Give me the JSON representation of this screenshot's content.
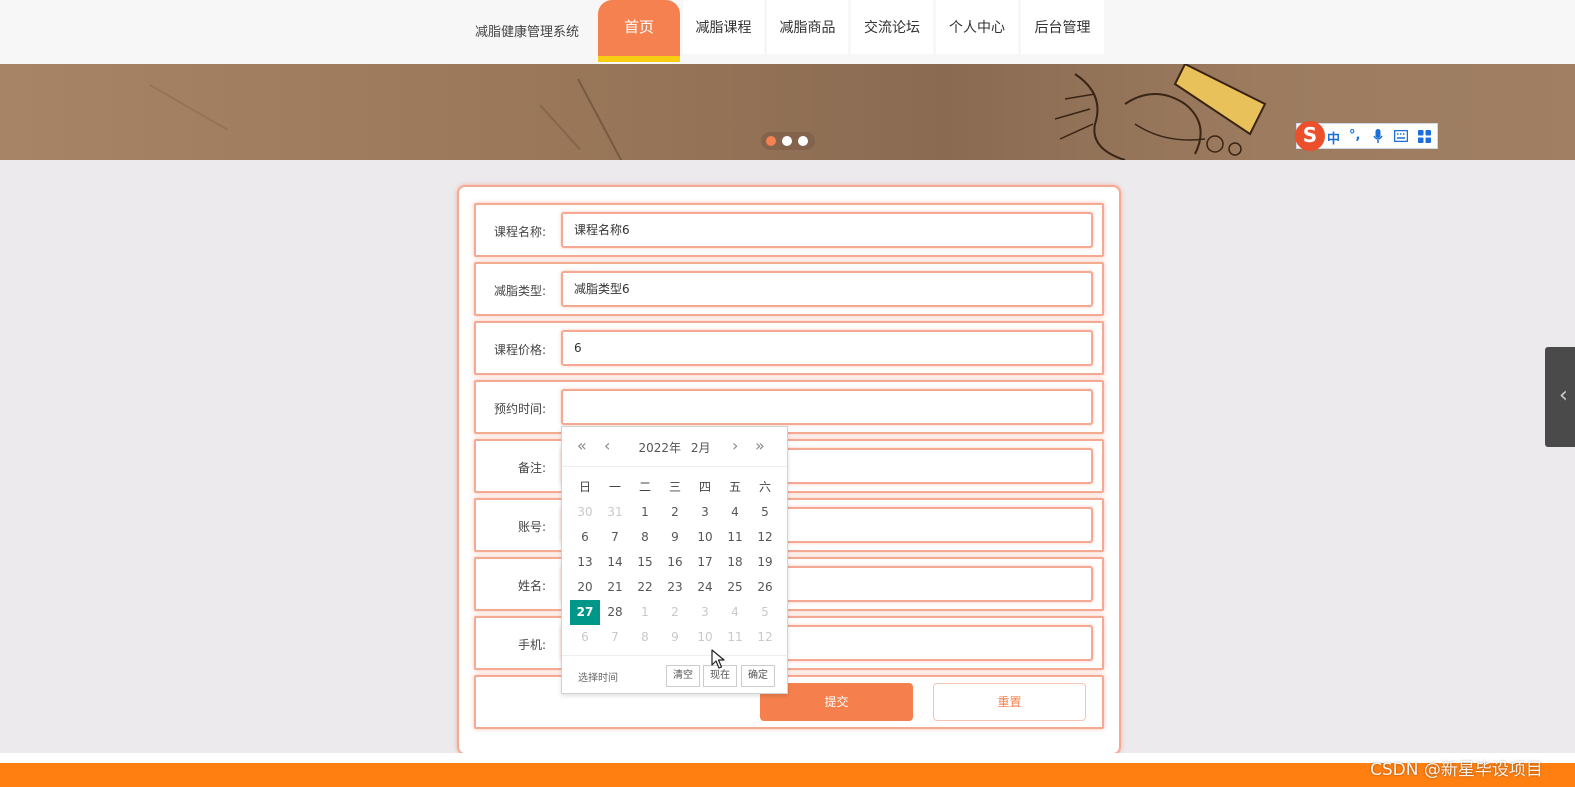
{
  "header": {
    "brand": "减脂健康管理系统",
    "nav": [
      {
        "label": "首页",
        "active": true
      },
      {
        "label": "减脂课程",
        "active": false
      },
      {
        "label": "减脂商品",
        "active": false
      },
      {
        "label": "交流论坛",
        "active": false
      },
      {
        "label": "个人中心",
        "active": false
      },
      {
        "label": "后台管理",
        "active": false
      }
    ]
  },
  "banner": {
    "slide_count": 3,
    "active_slide": 1
  },
  "ime_toolbar": {
    "logo": "S",
    "items": [
      "中",
      "°,",
      "mic-icon",
      "keyboard-icon",
      "grid-icon"
    ]
  },
  "form": {
    "fields": [
      {
        "label": "课程名称:",
        "value": "课程名称6"
      },
      {
        "label": "减脂类型:",
        "value": "减脂类型6"
      },
      {
        "label": "课程价格:",
        "value": "6"
      },
      {
        "label": "预约时间:",
        "value": ""
      },
      {
        "label": "备注:",
        "value": ""
      },
      {
        "label": "账号:",
        "value": ""
      },
      {
        "label": "姓名:",
        "value": ""
      },
      {
        "label": "手机:",
        "value": ""
      }
    ],
    "submit_label": "提交",
    "reset_label": "重置"
  },
  "datepicker": {
    "year_label": "2022年",
    "month_label": "2月",
    "weekdays": [
      "日",
      "一",
      "二",
      "三",
      "四",
      "五",
      "六"
    ],
    "weeks": [
      [
        [
          "30",
          0
        ],
        [
          "31",
          0
        ],
        [
          "1",
          1
        ],
        [
          "2",
          1
        ],
        [
          "3",
          1
        ],
        [
          "4",
          1
        ],
        [
          "5",
          1
        ]
      ],
      [
        [
          "6",
          1
        ],
        [
          "7",
          1
        ],
        [
          "8",
          1
        ],
        [
          "9",
          1
        ],
        [
          "10",
          1
        ],
        [
          "11",
          1
        ],
        [
          "12",
          1
        ]
      ],
      [
        [
          "13",
          1
        ],
        [
          "14",
          1
        ],
        [
          "15",
          1
        ],
        [
          "16",
          1
        ],
        [
          "17",
          1
        ],
        [
          "18",
          1
        ],
        [
          "19",
          1
        ]
      ],
      [
        [
          "20",
          1
        ],
        [
          "21",
          1
        ],
        [
          "22",
          1
        ],
        [
          "23",
          1
        ],
        [
          "24",
          1
        ],
        [
          "25",
          1
        ],
        [
          "26",
          1
        ]
      ],
      [
        [
          "27",
          1
        ],
        [
          "28",
          1
        ],
        [
          "1",
          0
        ],
        [
          "2",
          0
        ],
        [
          "3",
          0
        ],
        [
          "4",
          0
        ],
        [
          "5",
          0
        ]
      ],
      [
        [
          "6",
          0
        ],
        [
          "7",
          0
        ],
        [
          "8",
          0
        ],
        [
          "9",
          0
        ],
        [
          "10",
          0
        ],
        [
          "11",
          0
        ],
        [
          "12",
          0
        ]
      ]
    ],
    "selected_day": "27",
    "time_label": "选择时间",
    "clear_label": "清空",
    "now_label": "现在",
    "confirm_label": "确定",
    "selected_color": "#009688"
  },
  "watermark": "CSDN @新星毕设项目",
  "colors": {
    "accent": "#f58150",
    "nav_underline": "#f8cd12",
    "footer": "#ff7f11"
  }
}
